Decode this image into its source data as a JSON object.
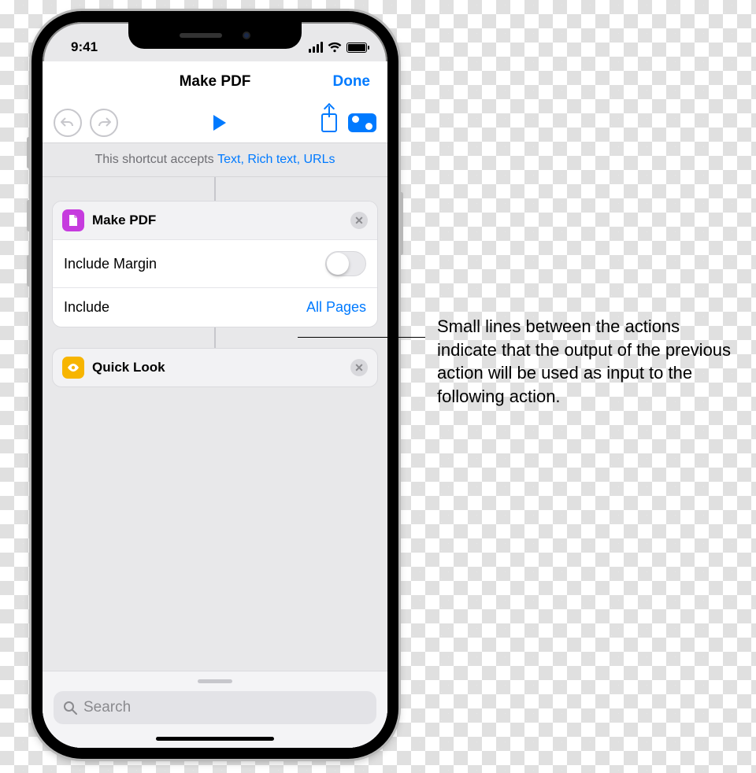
{
  "status": {
    "time": "9:41"
  },
  "nav": {
    "title": "Make PDF",
    "done": "Done"
  },
  "accepts": {
    "prefix": "This shortcut accepts ",
    "types": "Text, Rich text, URLs"
  },
  "actions": {
    "make_pdf": {
      "title": "Make PDF",
      "include_margin_label": "Include Margin",
      "include_label": "Include",
      "include_value": "All Pages"
    },
    "quick_look": {
      "title": "Quick Look"
    }
  },
  "search": {
    "placeholder": "Search"
  },
  "callout": "Small lines between the actions indicate that the output of the previous action will be used as input to the following action."
}
